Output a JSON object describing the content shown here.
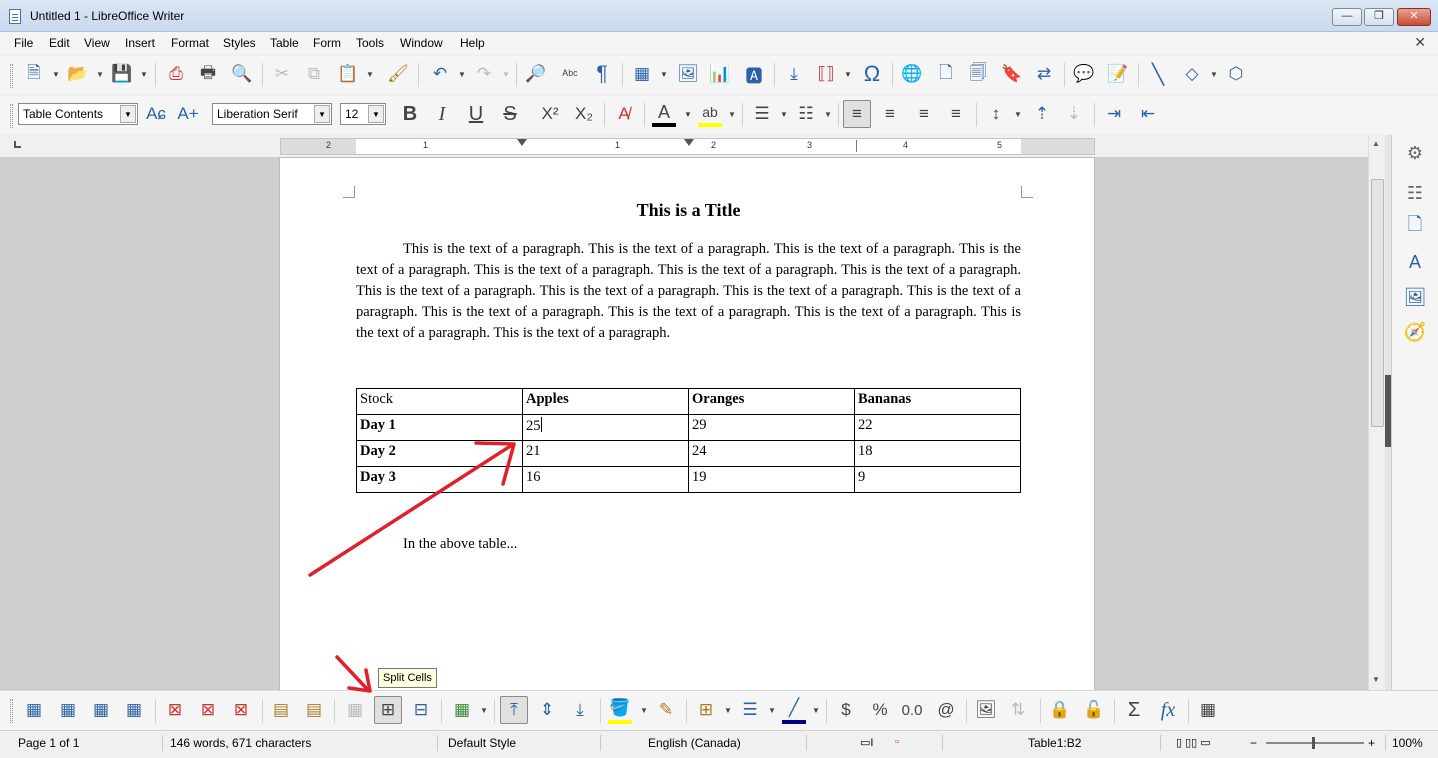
{
  "window": {
    "title": "Untitled 1 - LibreOffice Writer",
    "minimize_label": "—",
    "maximize_label": "❐",
    "close_label": "✕"
  },
  "menu": [
    "File",
    "Edit",
    "View",
    "Insert",
    "Format",
    "Styles",
    "Table",
    "Form",
    "Tools",
    "Window",
    "Help"
  ],
  "formatting": {
    "paragraph_style": "Table Contents",
    "font_name": "Liberation Serif",
    "font_size": "12"
  },
  "document": {
    "title": "This is a Title",
    "paragraph": "This is the text of a paragraph.  This is the text of a paragraph.  This is the text of a paragraph.  This is the text of a paragraph.  This is the text of a paragraph.  This is the text of a paragraph.  This is the text of a paragraph.  This is the text of a paragraph.  This is the text of a paragraph.  This is the text of a paragraph.  This is the text of a paragraph.  This is the text of a paragraph.  This is the text of a paragraph.  This is the text of a paragraph.  This is the text of a paragraph.  This is the text of a paragraph.",
    "table": {
      "headers": [
        "Stock",
        "Apples",
        "Oranges",
        "Bananas"
      ],
      "rows": [
        [
          "Day 1",
          "25",
          "29",
          "22"
        ],
        [
          "Day 2",
          "21",
          "24",
          "18"
        ],
        [
          "Day 3",
          "16",
          "19",
          "9"
        ]
      ]
    },
    "after_text": "In the above table..."
  },
  "ruler": {
    "labels": [
      "2",
      "1",
      "1",
      "2",
      "3",
      "4",
      "5"
    ]
  },
  "tooltip": "Split Cells",
  "status": {
    "page": "Page 1 of 1",
    "words": "146 words, 671 characters",
    "page_style": "Default Style",
    "language": "English (Canada)",
    "cell": "Table1:B2",
    "zoom": "100%"
  },
  "colors": {
    "accent": "#2a62a8",
    "annotation_arrow": "#e0202a",
    "font_color_bar": "#000000",
    "highlight_color_bar": "#ffff00",
    "border_color_bar": "#000080"
  },
  "icons": {
    "toolbar1": [
      "new-document-icon",
      "open-folder-icon",
      "save-icon",
      "export-pdf-icon",
      "print-icon",
      "print-preview-icon",
      "cut-icon",
      "copy-icon",
      "paste-icon",
      "clone-formatting-icon",
      "undo-icon",
      "redo-icon",
      "find-replace-icon",
      "spelling-icon",
      "formatting-marks-icon",
      "insert-table-icon",
      "insert-image-icon",
      "insert-chart-icon",
      "insert-textbox-icon",
      "page-break-icon",
      "insert-field-icon",
      "special-character-icon",
      "hyperlink-icon",
      "footnote-icon",
      "endnote-icon",
      "bookmark-icon",
      "cross-reference-icon",
      "comment-icon",
      "track-changes-icon",
      "line-icon",
      "basic-shapes-icon",
      "draw-functions-icon"
    ],
    "table_toolbar": [
      "insert-rows-above-icon",
      "insert-rows-below-icon",
      "insert-columns-before-icon",
      "insert-columns-after-icon",
      "delete-rows-icon",
      "delete-columns-icon",
      "delete-table-icon",
      "select-cell-icon",
      "select-table-icon",
      "merge-cells-icon",
      "split-cells-icon",
      "split-table-icon",
      "optimize-size-icon",
      "align-top-icon",
      "center-vertically-icon",
      "align-bottom-icon",
      "table-background-color-icon",
      "autoformat-icon",
      "borders-icon",
      "border-style-icon",
      "border-color-icon",
      "currency-icon",
      "percent-icon",
      "decimal-format-icon",
      "number-format-icon",
      "insert-caption-icon",
      "sort-icon",
      "protect-cells-icon",
      "unprotect-cells-icon",
      "sum-icon",
      "formula-icon",
      "table-properties-icon"
    ]
  }
}
